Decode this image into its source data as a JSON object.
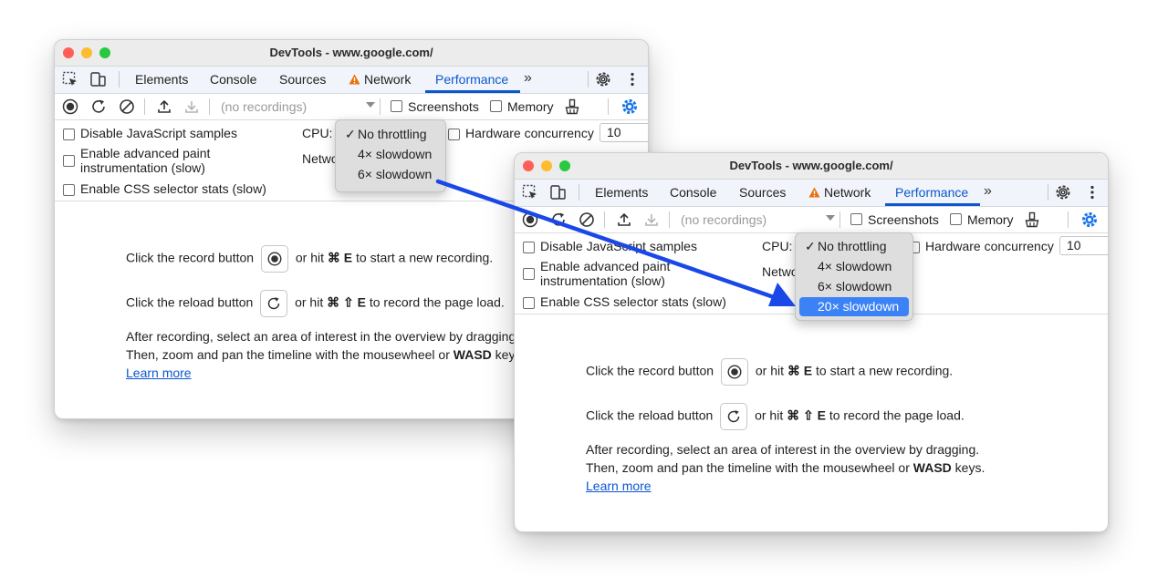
{
  "windows": [
    {
      "title": "DevTools - www.google.com/",
      "tabs": [
        "Elements",
        "Console",
        "Sources",
        "Network",
        "Performance"
      ],
      "active_tab": "Performance",
      "toolbar": {
        "recordings_placeholder": "(no recordings)",
        "screenshots_label": "Screenshots",
        "memory_label": "Memory"
      },
      "settings": {
        "disable_js": "Disable JavaScript samples",
        "paint_line1": "Enable advanced paint",
        "paint_line2": "instrumentation (slow)",
        "css_stats": "Enable CSS selector stats (slow)",
        "cpu_label": "CPU:",
        "network_label": "Netwo",
        "hw_label": "Hardware concurrency",
        "hw_value": "10"
      },
      "cpu_dropdown": {
        "checkmark": "✓",
        "options": [
          "No throttling",
          "4× slowdown",
          "6× slowdown"
        ],
        "selected": "No throttling"
      },
      "landing": {
        "record_pre": "Click the record button",
        "record_post": "or hit",
        "record_keys": "⌘ E",
        "record_end": "to start a new recording.",
        "reload_pre": "Click the reload button",
        "reload_post": "or hit",
        "reload_keys": "⌘ ⇧ E",
        "reload_end": "to record the page load.",
        "after1": "After recording, select an area of interest in the overview by dragging.",
        "after2a": "Then, zoom and pan the timeline with the mousewheel or",
        "after2b": "WASD",
        "after2c": "keys.",
        "learn_more": "Learn more"
      }
    },
    {
      "title": "DevTools - www.google.com/",
      "tabs": [
        "Elements",
        "Console",
        "Sources",
        "Network",
        "Performance"
      ],
      "active_tab": "Performance",
      "toolbar": {
        "recordings_placeholder": "(no recordings)",
        "screenshots_label": "Screenshots",
        "memory_label": "Memory"
      },
      "settings": {
        "disable_js": "Disable JavaScript samples",
        "paint_line1": "Enable advanced paint",
        "paint_line2": "instrumentation (slow)",
        "css_stats": "Enable CSS selector stats (slow)",
        "cpu_label": "CPU:",
        "network_label": "Netwo",
        "hw_label": "Hardware concurrency",
        "hw_value": "10"
      },
      "cpu_dropdown": {
        "checkmark": "✓",
        "options": [
          "No throttling",
          "4× slowdown",
          "6× slowdown",
          "20× slowdown"
        ],
        "selected": "No throttling",
        "highlighted": "20× slowdown"
      },
      "landing": {
        "record_pre": "Click the record button",
        "record_post": "or hit",
        "record_keys": "⌘ E",
        "record_end": "to start a new recording.",
        "reload_pre": "Click the reload button",
        "reload_post": "or hit",
        "reload_keys": "⌘ ⇧ E",
        "reload_end": "to record the page load.",
        "after1": "After recording, select an area of interest in the overview by dragging.",
        "after2a": "Then, zoom and pan the timeline with the mousewheel or",
        "after2b": "WASD",
        "after2c": "keys.",
        "learn_more": "Learn more"
      }
    }
  ],
  "colors": {
    "accent": "#0b57d0",
    "annotation_arrow": "#1a47e8",
    "dropdown_highlight": "#3b82f6"
  },
  "icons": [
    "inspect-element-icon",
    "device-toolbar-icon",
    "warning-icon",
    "more-tabs-icon",
    "gear-icon",
    "kebab-menu-icon",
    "record-icon",
    "reload-icon",
    "clear-icon",
    "upload-icon",
    "download-icon",
    "garbage-collect-icon",
    "capture-settings-icon"
  ]
}
